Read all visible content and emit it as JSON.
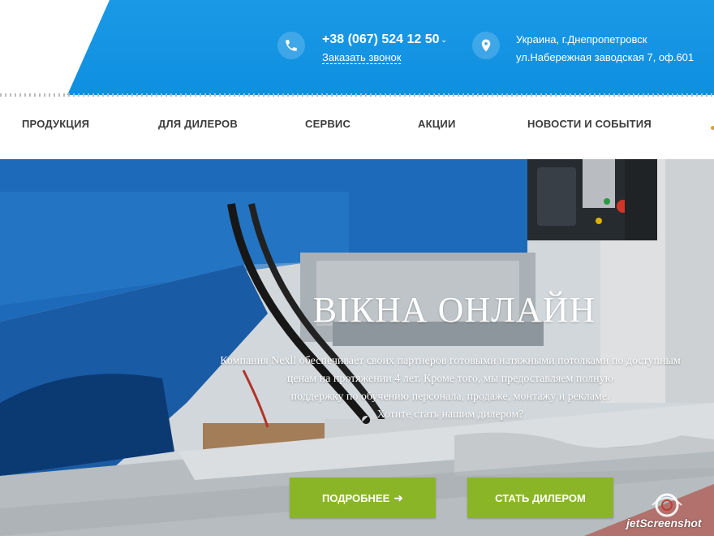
{
  "header": {
    "phone": "+38 (067) 524 12 50",
    "callback_label": "Заказать звонок",
    "address_line1": "Украина, г.Днепропетровск",
    "address_line2": "ул.Набережная заводская 7, оф.601",
    "brand_color": "#1a99e6"
  },
  "nav": {
    "items": [
      {
        "label": "ПРОДУКЦИЯ"
      },
      {
        "label": "ДЛЯ ДИЛЕРОВ"
      },
      {
        "label": "СЕРВИС"
      },
      {
        "label": "АКЦИИ"
      },
      {
        "label": "НОВОСТИ И СОБЫТИЯ"
      }
    ]
  },
  "hero": {
    "title": "ВІКНА ОНЛАЙН",
    "text_lines": [
      "Компания Nexll обеспечивает своих партнеров готовыми натяжными потолками по доступным",
      "ценам на протяжении 4 лет. Кроме того, мы предоставляем полную",
      "поддержку по обучению персонала, продаже, монтажу и рекламе.",
      "Хотите стать нашим дилером?"
    ],
    "btn_more": "ПОДРОБНЕЕ",
    "btn_more_icon": "arrow-right-icon",
    "btn_dealer": "СТАТЬ ДИЛЕРОМ",
    "accent_color": "#8ab526"
  },
  "watermark": {
    "text": "jetScreenshot"
  }
}
